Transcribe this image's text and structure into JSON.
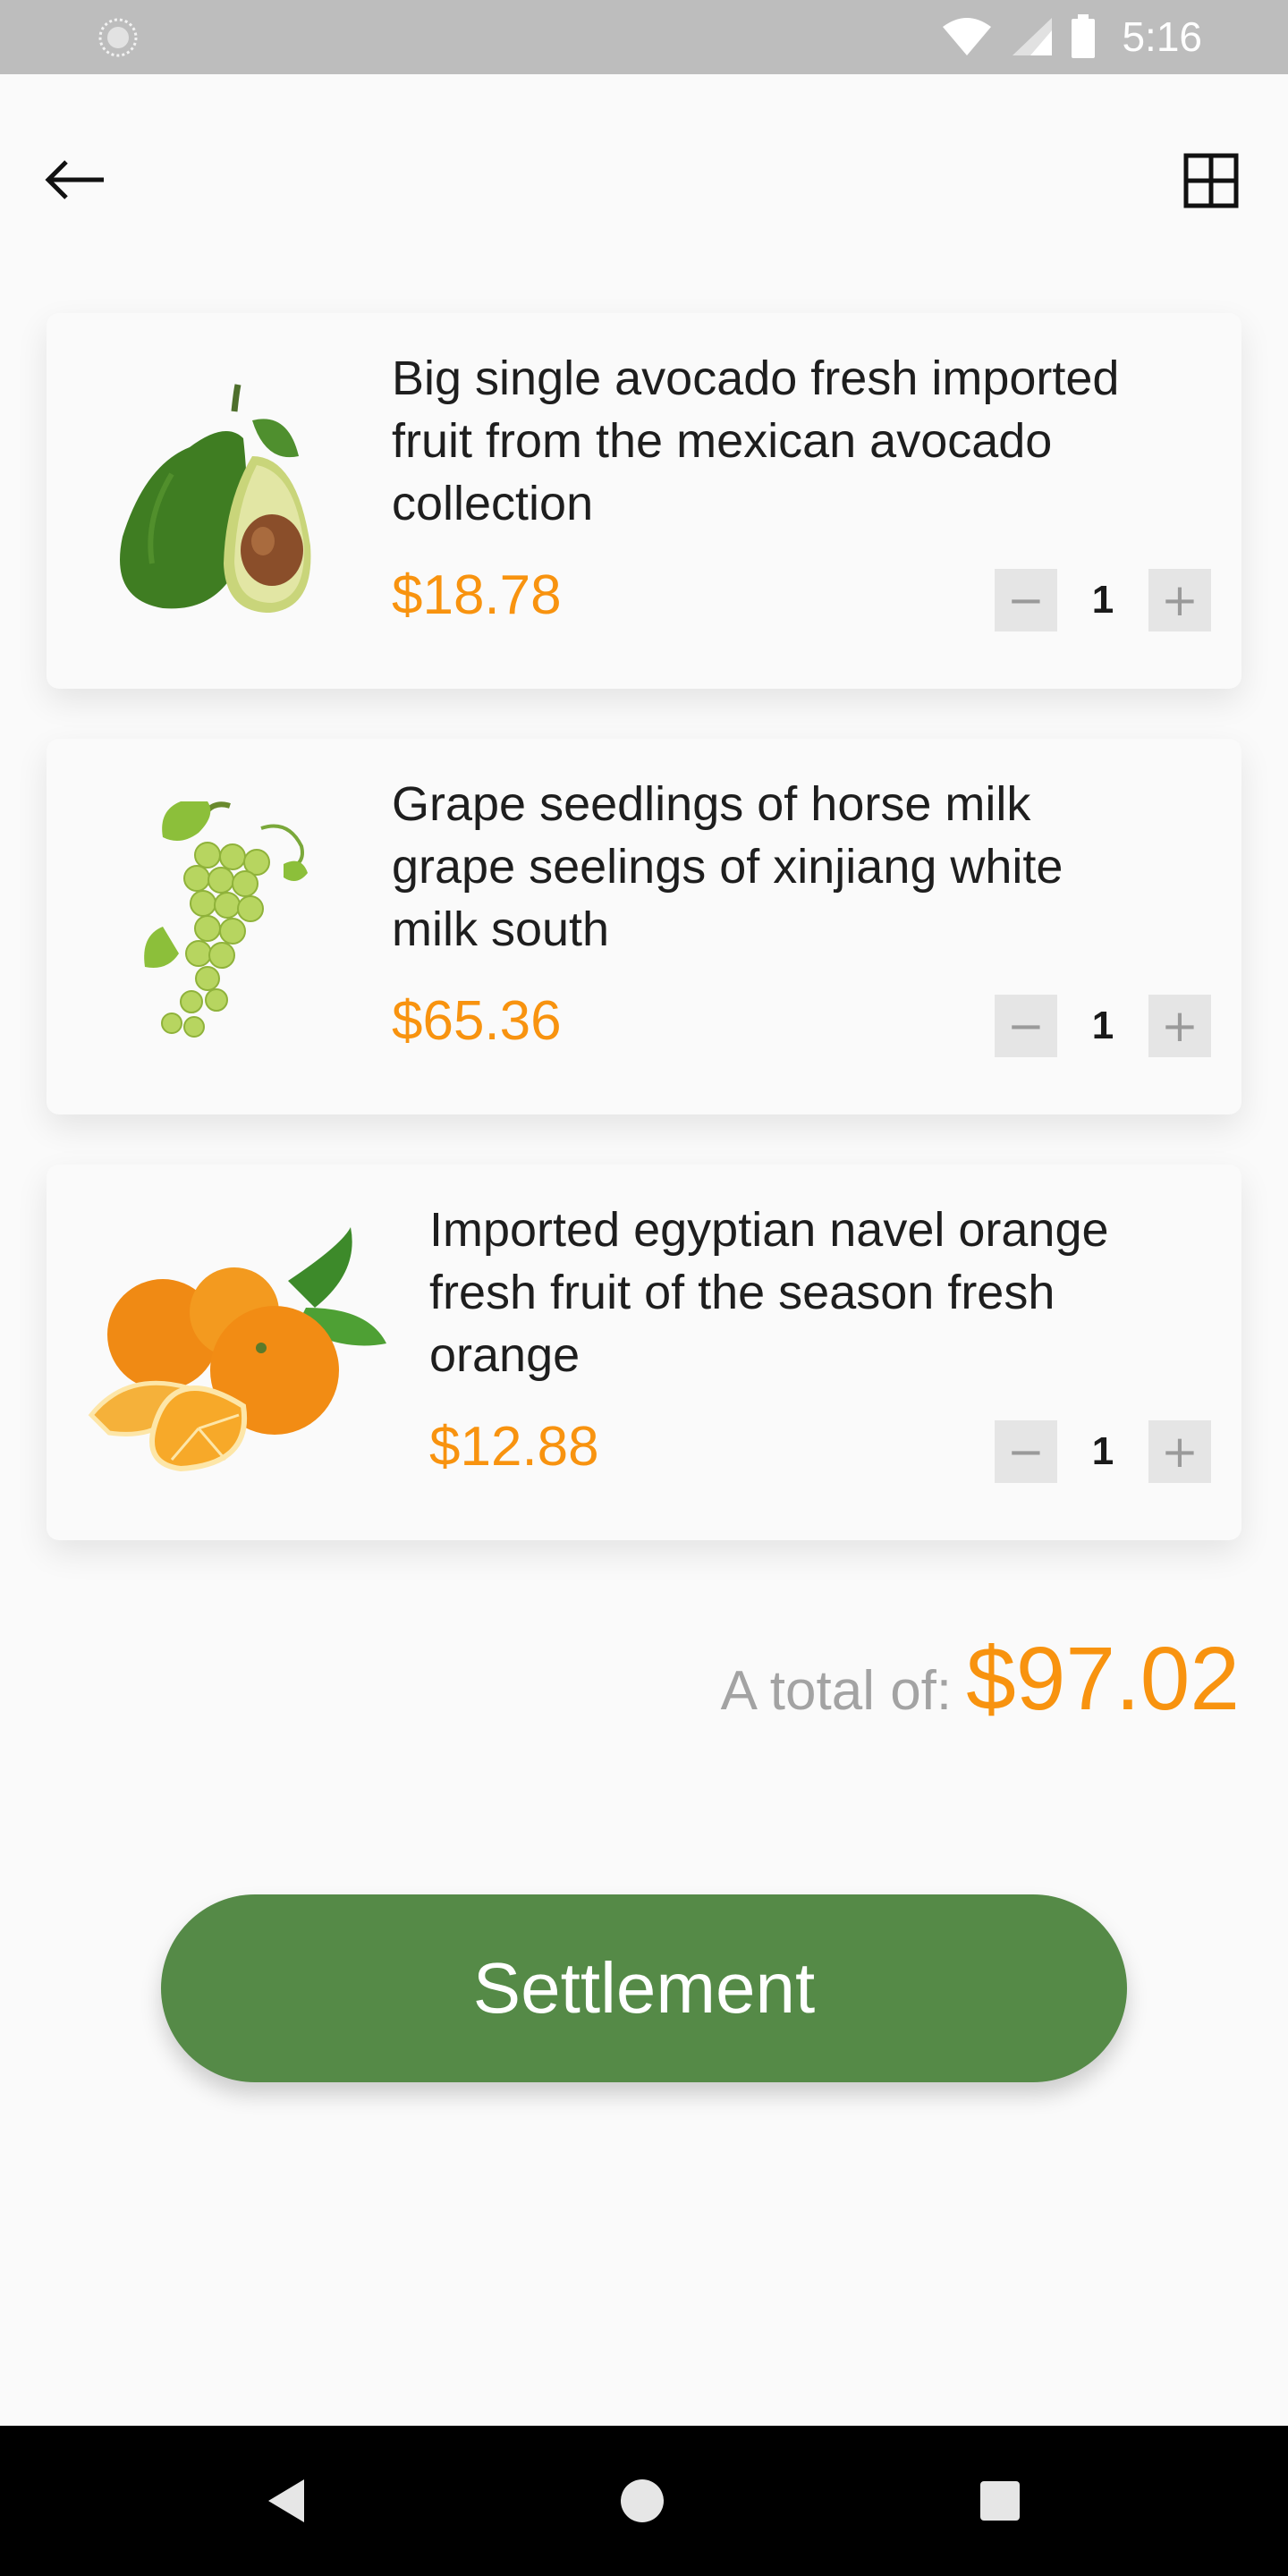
{
  "status_bar": {
    "time": "5:16"
  },
  "products": [
    {
      "title_lines": [
        "Big single avocado fresh imported",
        "fruit from the mexican avocado",
        "collection"
      ],
      "price": "$18.78",
      "qty": "1",
      "image_icon": "avocado-image"
    },
    {
      "title_lines": [
        "Grape seedlings of horse milk",
        "grape seelings of xinjiang white",
        "milk south"
      ],
      "price": "$65.36",
      "qty": "1",
      "image_icon": "grape-image"
    },
    {
      "title_lines": [
        "Imported egyptian navel orange",
        "fresh fruit of the season fresh",
        "orange"
      ],
      "price": "$12.88",
      "qty": "1",
      "image_icon": "orange-image"
    }
  ],
  "qty_controls": {
    "minus": "−",
    "plus": "+"
  },
  "total": {
    "label": "A total of:",
    "amount": "$97.02"
  },
  "settlement_button": {
    "label": "Settlement"
  },
  "colors": {
    "accent_orange": "#f8930f",
    "button_green": "#558a47",
    "status_bar": "#bdbdbd"
  }
}
